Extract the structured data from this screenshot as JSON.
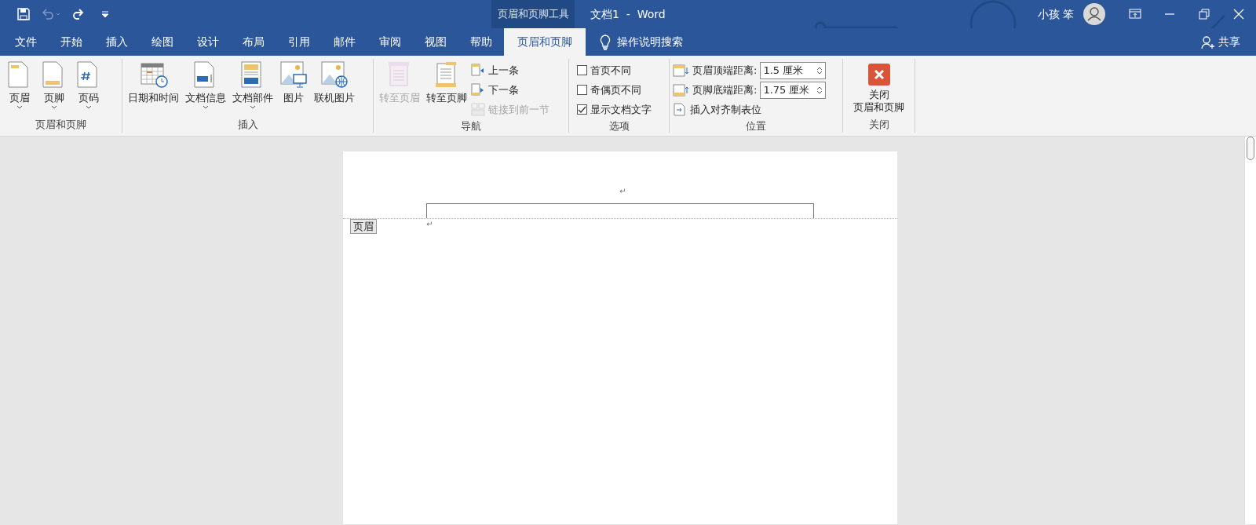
{
  "title_bar": {
    "context_tool": "页眉和页脚工具",
    "document_title": "文档1  -  Word",
    "user_name": "小孩 笨"
  },
  "tabs": [
    {
      "label": "文件",
      "selected": false
    },
    {
      "label": "开始",
      "selected": false
    },
    {
      "label": "插入",
      "selected": false
    },
    {
      "label": "绘图",
      "selected": false
    },
    {
      "label": "设计",
      "selected": false
    },
    {
      "label": "布局",
      "selected": false
    },
    {
      "label": "引用",
      "selected": false
    },
    {
      "label": "邮件",
      "selected": false
    },
    {
      "label": "审阅",
      "selected": false
    },
    {
      "label": "视图",
      "selected": false
    },
    {
      "label": "帮助",
      "selected": false
    },
    {
      "label": "页眉和页脚",
      "selected": true
    }
  ],
  "tell_me": "操作说明搜索",
  "share": "共享",
  "ribbon_groups": [
    {
      "label": "页眉和页脚",
      "items": [
        {
          "kind": "large",
          "label": "页眉",
          "dropdown": true,
          "disabled": false
        },
        {
          "kind": "large",
          "label": "页脚",
          "dropdown": true,
          "disabled": false
        },
        {
          "kind": "large",
          "label": "页码",
          "dropdown": true,
          "disabled": false
        }
      ]
    },
    {
      "label": "插入",
      "items": [
        {
          "kind": "large",
          "label": "日期和时间",
          "dropdown": false,
          "disabled": false
        },
        {
          "kind": "large",
          "label": "文档信息",
          "dropdown": true,
          "disabled": false
        },
        {
          "kind": "large",
          "label": "文档部件",
          "dropdown": true,
          "disabled": false
        },
        {
          "kind": "large",
          "label": "图片",
          "dropdown": false,
          "disabled": false
        },
        {
          "kind": "large",
          "label": "联机图片",
          "dropdown": false,
          "disabled": false
        }
      ]
    },
    {
      "label": "导航",
      "items": [
        {
          "kind": "large",
          "label": "转至页眉",
          "dropdown": false,
          "disabled": true
        },
        {
          "kind": "large",
          "label": "转至页脚",
          "dropdown": false,
          "disabled": false
        },
        {
          "kind": "stack",
          "children": [
            {
              "kind": "small",
              "label": "上一条",
              "disabled": false
            },
            {
              "kind": "small",
              "label": "下一条",
              "disabled": false
            },
            {
              "kind": "small",
              "label": "链接到前一节",
              "disabled": true
            }
          ]
        }
      ]
    },
    {
      "label": "选项",
      "items": [
        {
          "kind": "stack",
          "children": [
            {
              "kind": "check",
              "label": "首页不同",
              "checked": false
            },
            {
              "kind": "check",
              "label": "奇偶页不同",
              "checked": false
            },
            {
              "kind": "check",
              "label": "显示文档文字",
              "checked": true
            }
          ]
        }
      ]
    },
    {
      "label": "位置",
      "items": [
        {
          "kind": "stack",
          "children": [
            {
              "kind": "spin",
              "label": "页眉顶端距离:",
              "value": "1.5 厘米"
            },
            {
              "kind": "spin",
              "label": "页脚底端距离:",
              "value": "1.75 厘米"
            },
            {
              "kind": "small",
              "label": "插入对齐制表位",
              "disabled": false
            }
          ]
        }
      ]
    },
    {
      "label": "关闭",
      "items": [
        {
          "kind": "close",
          "label_lines": [
            "关闭",
            "页眉和页脚"
          ]
        }
      ]
    }
  ],
  "document": {
    "header_paragraph_mark": "↵",
    "header_tag": "页眉",
    "body_paragraph_mark": "↵"
  }
}
